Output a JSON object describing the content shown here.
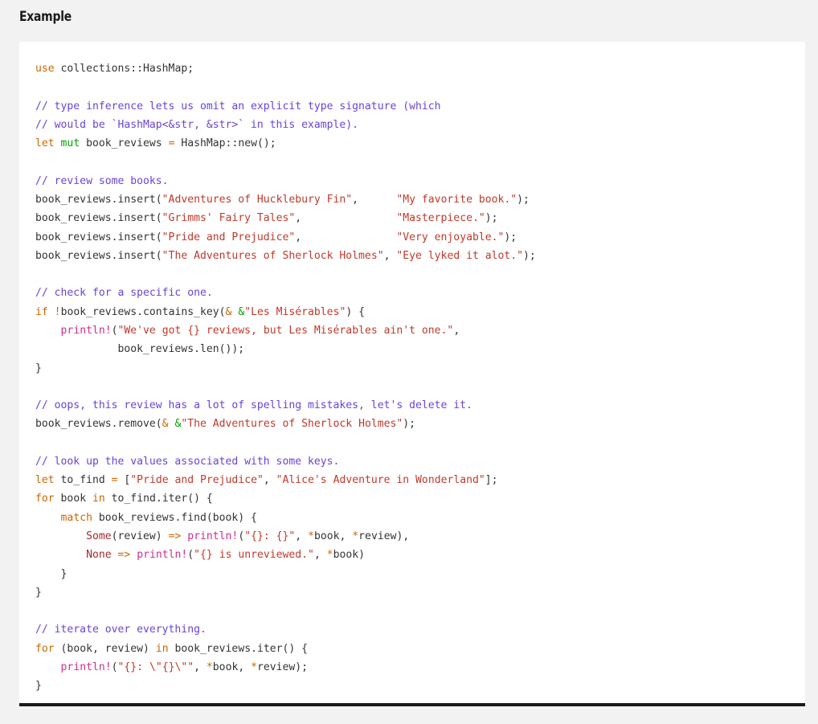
{
  "page": {
    "background_color": "#f2f2f2",
    "title": "Example"
  },
  "code_block": {
    "background_color": "#ffffff",
    "border_bottom_color": "#1a1a1a",
    "language": "rust",
    "theme_colors": {
      "keyword": "#cd6600",
      "keyword_alt": "#00a000",
      "comment": "#6a43d8",
      "string": "#c0392b",
      "macro": "#d12d8f",
      "type": "#a52a2a",
      "operator": "#cd6600",
      "plain": "#333333"
    },
    "lines": [
      "use collections::HashMap;",
      "",
      "// type inference lets us omit an explicit type signature (which",
      "// would be `HashMap<&str, &str>` in this example).",
      "let mut book_reviews = HashMap::new();",
      "",
      "// review some books.",
      "book_reviews.insert(\"Adventures of Hucklebury Fin\",      \"My favorite book.\");",
      "book_reviews.insert(\"Grimms' Fairy Tales\",               \"Masterpiece.\");",
      "book_reviews.insert(\"Pride and Prejudice\",               \"Very enjoyable.\");",
      "book_reviews.insert(\"The Adventures of Sherlock Holmes\", \"Eye lyked it alot.\");",
      "",
      "// check for a specific one.",
      "if !book_reviews.contains_key(& &\"Les Misérables\") {",
      "    println!(\"We've got {} reviews, but Les Misérables ain't one.\",",
      "             book_reviews.len());",
      "}",
      "",
      "// oops, this review has a lot of spelling mistakes, let's delete it.",
      "book_reviews.remove(& &\"The Adventures of Sherlock Holmes\");",
      "",
      "// look up the values associated with some keys.",
      "let to_find = [\"Pride and Prejudice\", \"Alice's Adventure in Wonderland\"];",
      "for book in to_find.iter() {",
      "    match book_reviews.find(book) {",
      "        Some(review) => println!(\"{}: {}\", *book, *review),",
      "        None => println!(\"{} is unreviewed.\", *book)",
      "    }",
      "}",
      "",
      "// iterate over everything.",
      "for (book, review) in book_reviews.iter() {",
      "    println!(\"{}: \\\"{}\\\"\", *book, *review);",
      "}"
    ]
  }
}
